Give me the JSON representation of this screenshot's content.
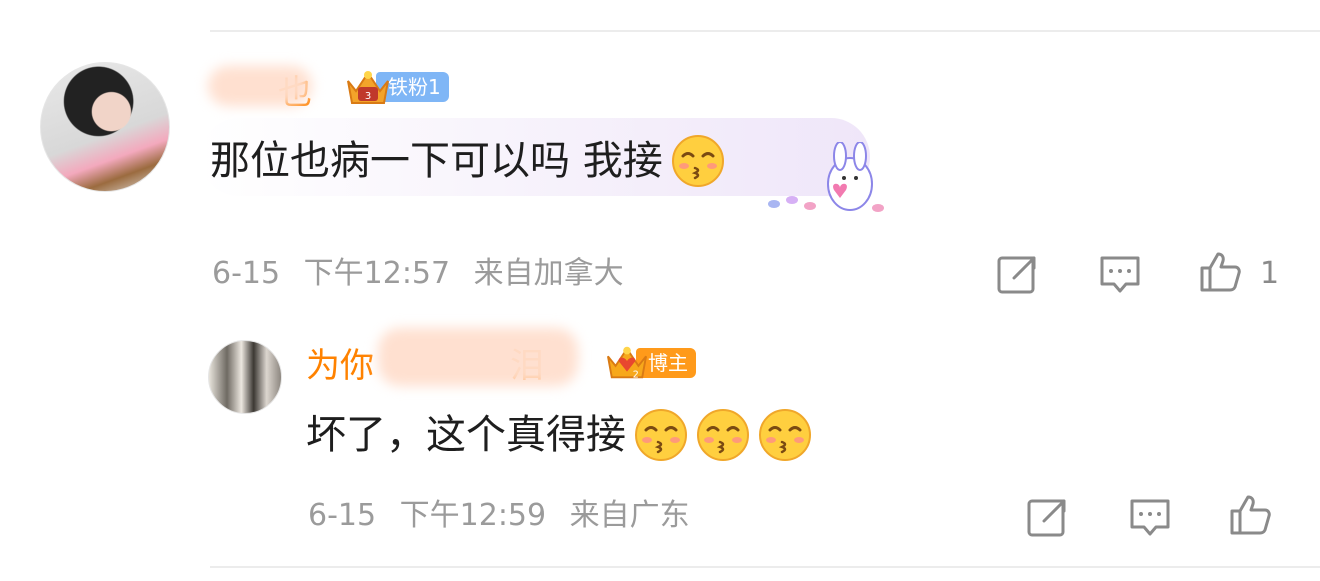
{
  "comment": {
    "username_visible": "也",
    "badge_label": "铁粉1",
    "text": "那位也病一下可以吗 我接",
    "date": "6-15",
    "time": "下午12:57",
    "location": "来自加拿大",
    "like_count": "1",
    "emoji_count": 1
  },
  "reply": {
    "username_start": "为你",
    "username_end": "泪",
    "badge_label": "博主",
    "text": "坏了，这个真得接",
    "date": "6-15",
    "time": "下午12:59",
    "location": "来自广东",
    "emoji_count": 3
  },
  "icons": {
    "share": "share-icon",
    "comment": "comment-icon",
    "like": "thumbs-up-icon",
    "emoji": "kiss-face-emoji-icon",
    "decoration": "bunny-sticker-icon"
  },
  "colors": {
    "username": "#ff8200",
    "iron_badge": "#7fb6f6",
    "blogger_badge": "#ff9a1a",
    "meta_text": "#9b9b9b",
    "body_text": "#1e1e1e"
  }
}
